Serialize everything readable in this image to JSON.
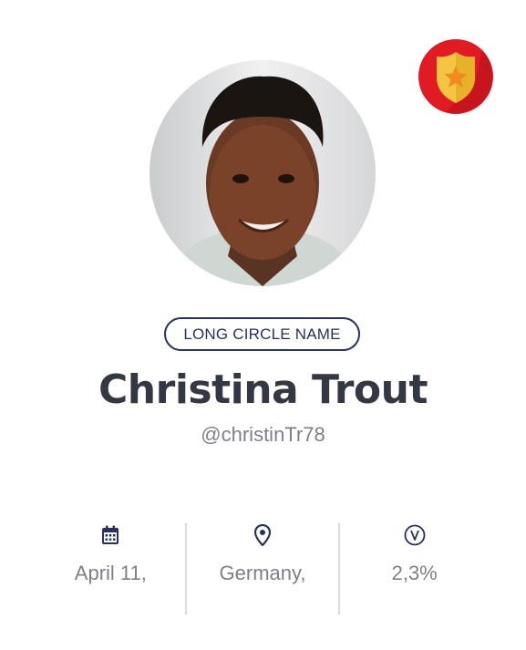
{
  "profile": {
    "circle_name": "LONG CIRCLE NAME",
    "name": "Christina Trout",
    "handle": "@christinTr78",
    "badge_icon": "police-shield-icon",
    "badge_colors": {
      "circle": "#e01b24",
      "circle_shade": "#b5121b",
      "shield": "#f5c542",
      "star": "#f08c1f"
    }
  },
  "stats": [
    {
      "icon": "calendar-icon",
      "value": "April 11,"
    },
    {
      "icon": "location-pin-icon",
      "value": "Germany,"
    },
    {
      "icon": "v-circle-icon",
      "value": "2,3%"
    }
  ],
  "colors": {
    "accent": "#28335c",
    "text_dark": "#343842",
    "text_muted": "#7d808a",
    "divider": "#d9dadd"
  }
}
